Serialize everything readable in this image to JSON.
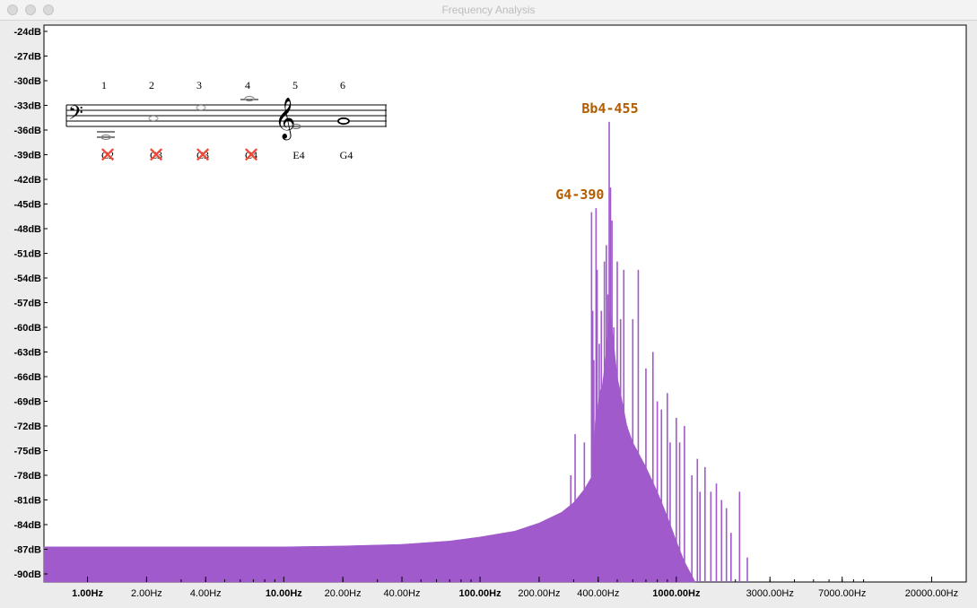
{
  "window": {
    "title": "Frequency Analysis"
  },
  "chart_data": {
    "type": "area",
    "title": "",
    "xlabel": "",
    "ylabel": "",
    "x_scale": "log",
    "xlim": [
      0.6,
      30000
    ],
    "ylim": [
      -91,
      -23
    ],
    "grid": false,
    "y_ticks": [
      "-24dB",
      "-27dB",
      "-30dB",
      "-33dB",
      "-36dB",
      "-39dB",
      "-42dB",
      "-45dB",
      "-48dB",
      "-51dB",
      "-54dB",
      "-57dB",
      "-60dB",
      "-63dB",
      "-66dB",
      "-69dB",
      "-72dB",
      "-75dB",
      "-78dB",
      "-81dB",
      "-84dB",
      "-87dB",
      "-90dB"
    ],
    "x_ticks": [
      {
        "v": 1,
        "label": "1.00Hz",
        "major": true
      },
      {
        "v": 2,
        "label": "2.00Hz",
        "major": false
      },
      {
        "v": 4,
        "label": "4.00Hz",
        "major": false
      },
      {
        "v": 10,
        "label": "10.00Hz",
        "major": true
      },
      {
        "v": 20,
        "label": "20.00Hz",
        "major": false
      },
      {
        "v": 40,
        "label": "40.00Hz",
        "major": false
      },
      {
        "v": 100,
        "label": "100.00Hz",
        "major": true
      },
      {
        "v": 200,
        "label": "200.00Hz",
        "major": false
      },
      {
        "v": 400,
        "label": "400.00Hz",
        "major": false
      },
      {
        "v": 1000,
        "label": "1000.00Hz",
        "major": true
      },
      {
        "v": 3000,
        "label": "3000.00Hz",
        "major": false
      },
      {
        "v": 7000,
        "label": "7000.00Hz",
        "major": false
      },
      {
        "v": 20000,
        "label": "20000.00Hz",
        "major": false
      }
    ],
    "series": [
      {
        "color": "#a05acb",
        "floor_db": -91,
        "points": [
          [
            0.6,
            -86.7
          ],
          [
            1,
            -86.7
          ],
          [
            2,
            -86.7
          ],
          [
            5,
            -86.7
          ],
          [
            10,
            -86.7
          ],
          [
            20,
            -86.6
          ],
          [
            40,
            -86.4
          ],
          [
            70,
            -86
          ],
          [
            100,
            -85.5
          ],
          [
            150,
            -84.8
          ],
          [
            200,
            -83.8
          ],
          [
            260,
            -82.5
          ],
          [
            300,
            -81.3
          ],
          [
            340,
            -79.7
          ],
          [
            370,
            -78.2
          ],
          [
            380,
            -76
          ],
          [
            385,
            -72
          ],
          [
            390,
            -70
          ],
          [
            395,
            -71
          ],
          [
            405,
            -68
          ],
          [
            420,
            -67
          ],
          [
            435,
            -64
          ],
          [
            450,
            -60
          ],
          [
            460,
            -58
          ],
          [
            480,
            -62
          ],
          [
            500,
            -66
          ],
          [
            520,
            -68
          ],
          [
            560,
            -72
          ],
          [
            600,
            -74
          ],
          [
            700,
            -77
          ],
          [
            800,
            -80
          ],
          [
            900,
            -83
          ],
          [
            1000,
            -86
          ],
          [
            1100,
            -88.5
          ],
          [
            1250,
            -91
          ]
        ],
        "spikes": [
          [
            290,
            -78
          ],
          [
            305,
            -73
          ],
          [
            340,
            -74
          ],
          [
            370,
            -46
          ],
          [
            375,
            -58
          ],
          [
            380,
            -64
          ],
          [
            390,
            -45.5
          ],
          [
            395,
            -53
          ],
          [
            405,
            -62
          ],
          [
            415,
            -58
          ],
          [
            430,
            -52
          ],
          [
            440,
            -50
          ],
          [
            448,
            -56
          ],
          [
            455,
            -35
          ],
          [
            462,
            -43
          ],
          [
            470,
            -47
          ],
          [
            480,
            -60
          ],
          [
            500,
            -52
          ],
          [
            520,
            -59
          ],
          [
            540,
            -53
          ],
          [
            560,
            -72
          ],
          [
            600,
            -59
          ],
          [
            620,
            -75
          ],
          [
            640,
            -53
          ],
          [
            700,
            -65
          ],
          [
            760,
            -63
          ],
          [
            800,
            -69
          ],
          [
            840,
            -70
          ],
          [
            900,
            -68
          ],
          [
            930,
            -74
          ],
          [
            1000,
            -71
          ],
          [
            1040,
            -74
          ],
          [
            1100,
            -72
          ],
          [
            1200,
            -78
          ],
          [
            1280,
            -76
          ],
          [
            1320,
            -80
          ],
          [
            1400,
            -77
          ],
          [
            1500,
            -80
          ],
          [
            1600,
            -79
          ],
          [
            1700,
            -81
          ],
          [
            1800,
            -82
          ],
          [
            1900,
            -85
          ],
          [
            2100,
            -80
          ],
          [
            2300,
            -88
          ]
        ]
      }
    ],
    "annotations": [
      {
        "x": 455,
        "y": -35,
        "text": "Bb4-455"
      },
      {
        "x": 390,
        "y": -45.5,
        "text": "G4-390"
      }
    ]
  },
  "score": {
    "numbers": [
      "1",
      "2",
      "3",
      "4",
      "5",
      "6"
    ],
    "notes": [
      "C2",
      "C3",
      "C3",
      "C4",
      "E4",
      "G4"
    ],
    "crossed": [
      true,
      true,
      true,
      true,
      false,
      false
    ],
    "bass_clef": "𝄢",
    "treble_clef": "𝄞",
    "cross_mark": "✕"
  }
}
